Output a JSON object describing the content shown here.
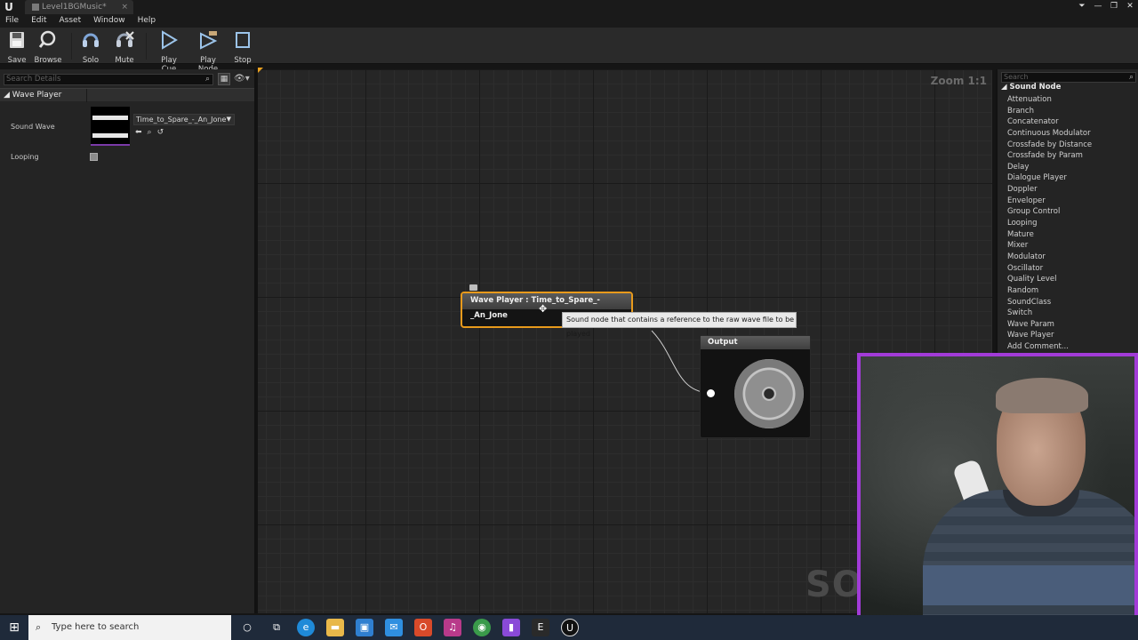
{
  "window": {
    "tab_title": "Level1BGMusic*",
    "tab_close": "×",
    "controls": [
      "⏷",
      "—",
      "❐",
      "✕"
    ]
  },
  "menu": [
    "File",
    "Edit",
    "Asset",
    "Window",
    "Help"
  ],
  "toolbar": {
    "buttons": [
      {
        "label": "Save",
        "icon": "save-icon"
      },
      {
        "label": "Browse",
        "icon": "browse-icon"
      },
      {
        "label": "Solo",
        "icon": "solo-icon"
      },
      {
        "label": "Mute",
        "icon": "mute-icon"
      },
      {
        "label": "Play Cue",
        "icon": "play-cue-icon"
      },
      {
        "label": "Play Node",
        "icon": "play-node-icon"
      },
      {
        "label": "Stop",
        "icon": "stop-icon"
      }
    ]
  },
  "details": {
    "search_placeholder": "Search Details",
    "category": "Wave Player",
    "sound_wave_label": "Sound Wave",
    "sound_wave_value": "Time_to_Spare_-_An_Jone",
    "looping_label": "Looping"
  },
  "graph": {
    "zoom": "Zoom 1:1",
    "wave_player_node_title": "Wave Player : Time_to_Spare_-_An_Jone",
    "tooltip": "Sound node that contains a reference to the raw wave file to be played",
    "output_node_title": "Output",
    "watermark": "SOUN"
  },
  "palette": {
    "search_placeholder": "Search",
    "category": "Sound Node",
    "items": [
      "Attenuation",
      "Branch",
      "Concatenator",
      "Continuous Modulator",
      "Crossfade by Distance",
      "Crossfade by Param",
      "Delay",
      "Dialogue Player",
      "Doppler",
      "Enveloper",
      "Group Control",
      "Looping",
      "Mature",
      "Mixer",
      "Modulator",
      "Oscillator",
      "Quality Level",
      "Random",
      "SoundClass",
      "Switch",
      "Wave Param",
      "Wave Player",
      "Add Comment..."
    ]
  },
  "taskbar": {
    "search_placeholder": "Type here to search"
  },
  "colors": {
    "node_selected_border": "#e89a1c",
    "webcam_border": "#a23bd8",
    "graph_bg": "#262626"
  }
}
